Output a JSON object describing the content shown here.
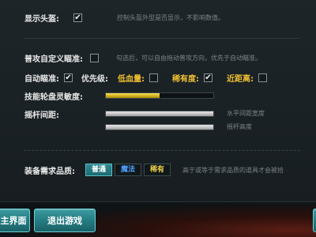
{
  "settings": {
    "show_head_plate": {
      "label": "显示头盔:",
      "checked": true,
      "hint": "控制头盔外型是否显示，不影响数值。"
    },
    "custom_aim": {
      "label": "普攻自定义瞄准:",
      "checked": false,
      "hint": "勾选后，可以自由拖动普攻方向，优先于自动瞄准。"
    },
    "auto_aim": {
      "label": "自动瞄准:",
      "checked": true,
      "priority_label": "优先级:",
      "options": [
        {
          "label": "低血量:",
          "checked": false,
          "color": "#f2c230"
        },
        {
          "label": "稀有度:",
          "checked": true,
          "color": "#f2c230"
        },
        {
          "label": "近距离:",
          "checked": false,
          "color": "#f2c230"
        }
      ]
    },
    "skill_wheel": {
      "label": "技能轮盘灵敏度:",
      "value_fraction": 0.5
    },
    "joystick": {
      "label": "摇杆间距:",
      "horizontal": {
        "hint": "水平间距宽度",
        "value_fraction": 1.0
      },
      "height": {
        "hint": "摇杆高度",
        "value_fraction": 1.0
      }
    },
    "equip_quality": {
      "label": "装备需求品质:",
      "options": [
        {
          "label": "普通",
          "selected": true
        },
        {
          "label": "魔法",
          "selected": false
        },
        {
          "label": "稀有",
          "selected": false
        }
      ],
      "hint": "高于或等于需求品质的道具才会被拾"
    }
  },
  "buttons": {
    "main_menu": "主界面",
    "exit_game": "退出游戏"
  },
  "colors": {
    "accent_teal": "#237a80",
    "gold": "#f2c230",
    "magic_blue": "#4fa0ff",
    "rare_yellow": "#f2d24a"
  }
}
